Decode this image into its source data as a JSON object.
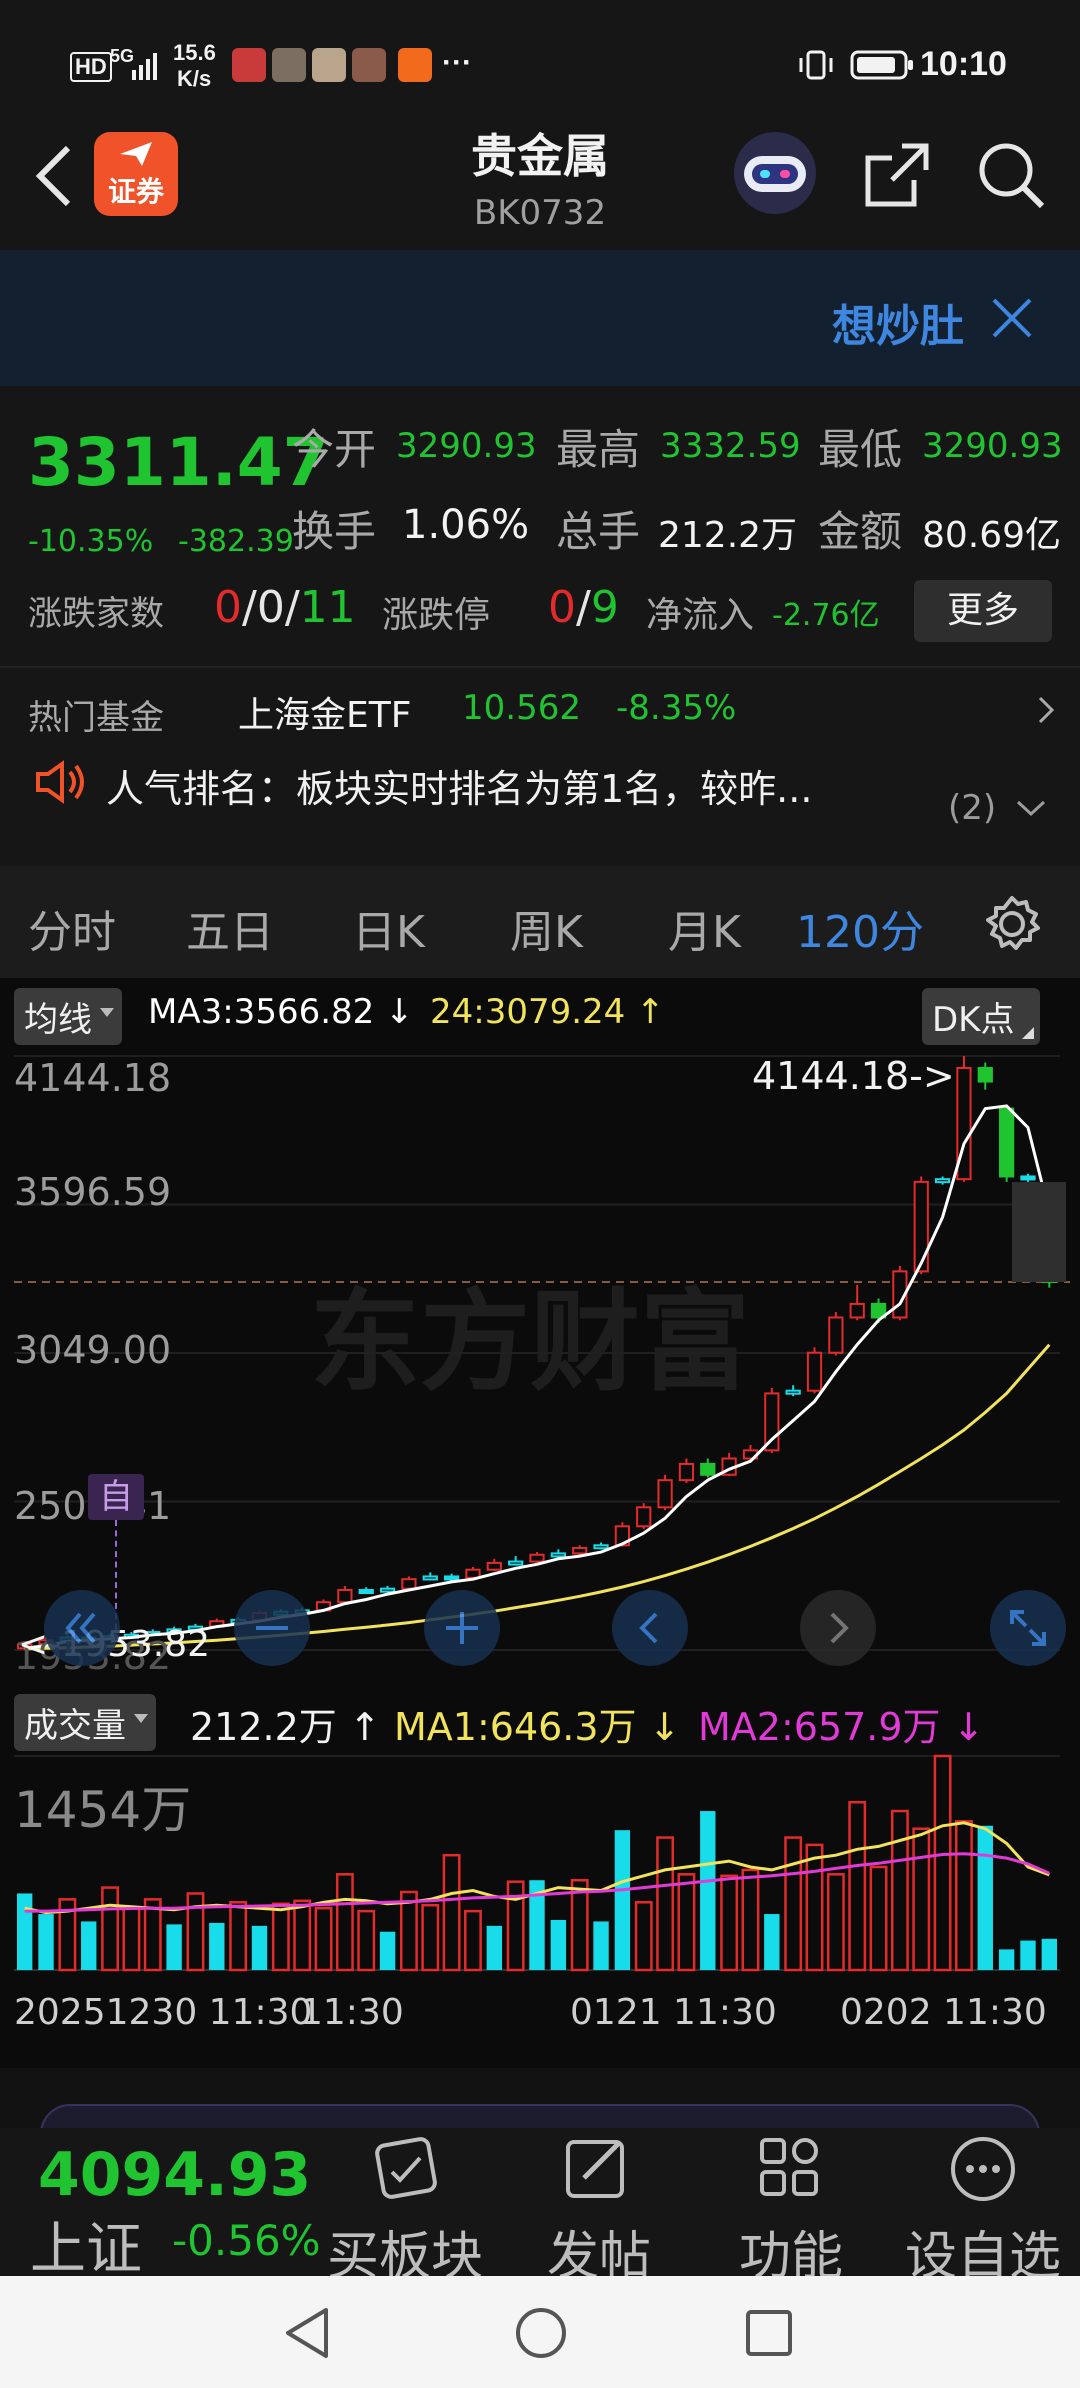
{
  "status_bar": {
    "network": "5G",
    "speed_value": "15.6",
    "speed_unit": "K/s",
    "more": "···",
    "time": "10:10",
    "hd": "HD"
  },
  "header": {
    "title": "贵金属",
    "code": "BK0732",
    "brand_badge": "证券"
  },
  "banner": {
    "text": "想炒肚"
  },
  "quote": {
    "price": "3311.47",
    "change_pct": "-10.35%",
    "change_abs": "-382.39",
    "open_label": "今开",
    "open_value": "3290.93",
    "high_label": "最高",
    "high_value": "3332.59",
    "low_label": "最低",
    "low_value": "3290.93",
    "turnover_label": "换手",
    "turnover_value": "1.06%",
    "volume_label": "总手",
    "volume_value": "212.2万",
    "amount_label": "金额",
    "amount_value": "80.69亿",
    "updown_label": "涨跌家数",
    "up": "0",
    "flat": "0",
    "down": "11",
    "limit_label": "涨跌停",
    "limit_up": "0",
    "limit_down": "9",
    "netflow_label": "净流入",
    "netflow_value": "-2.76亿",
    "more_button": "更多",
    "fund_label": "热门基金",
    "fund_name": "上海金ETF",
    "fund_price": "10.562",
    "fund_change": "-8.35%",
    "rank_text": "人气排名：板块实时排名为第1名，较昨...",
    "rank_count": "(2)"
  },
  "tabs": {
    "items": [
      "分时",
      "五日",
      "日K",
      "周K",
      "月K",
      "120分"
    ],
    "active_index": 5
  },
  "chart_legend": {
    "ma_selector": "均线",
    "ma3": "MA3:3566.82",
    "ma3_arrow": "↓",
    "ma24": "24:3079.24",
    "ma24_arrow": "↑",
    "dk_button": "DK点",
    "volume_selector": "成交量",
    "vol_value": "212.2万",
    "vol_arrow": "↑",
    "vol_ma1": "MA1:646.3万",
    "vol_ma1_arrow": "↓",
    "vol_ma2": "MA2:657.9万",
    "vol_ma2_arrow": "↓",
    "vol_max": "1454万",
    "price_high_marker": "4144.18->",
    "price_low_marker": "<-1953.82",
    "watermark": "东方财富",
    "auto_label": "自"
  },
  "chart_data": {
    "type": "candlestick",
    "y_ticks": [
      "4144.18",
      "3596.59",
      "3049.00",
      "2501.41",
      "1953.82"
    ],
    "ylim": [
      1953.82,
      4144.18
    ],
    "x_labels": [
      "20251230 11:30",
      "11:30",
      "0121 11:30",
      "0202 11:30"
    ],
    "candles": [
      {
        "o": 1960,
        "c": 1975,
        "h": 1985,
        "l": 1955
      },
      {
        "o": 1975,
        "c": 1990,
        "h": 2000,
        "l": 1965
      },
      {
        "o": 1990,
        "c": 2000,
        "h": 2010,
        "l": 1980
      },
      {
        "o": 2000,
        "c": 1995,
        "h": 2010,
        "l": 1985
      },
      {
        "o": 1995,
        "c": 2005,
        "h": 2015,
        "l": 1990
      },
      {
        "o": 2005,
        "c": 2010,
        "h": 2020,
        "l": 2000
      },
      {
        "o": 2010,
        "c": 2020,
        "h": 2030,
        "l": 2005
      },
      {
        "o": 2020,
        "c": 2030,
        "h": 2040,
        "l": 2015
      },
      {
        "o": 2030,
        "c": 2040,
        "h": 2050,
        "l": 2025
      },
      {
        "o": 2040,
        "c": 2060,
        "h": 2070,
        "l": 2035
      },
      {
        "o": 2060,
        "c": 2065,
        "h": 2075,
        "l": 2055
      },
      {
        "o": 2065,
        "c": 2090,
        "h": 2100,
        "l": 2060
      },
      {
        "o": 2090,
        "c": 2095,
        "h": 2105,
        "l": 2085
      },
      {
        "o": 2095,
        "c": 2100,
        "h": 2110,
        "l": 2090
      },
      {
        "o": 2100,
        "c": 2130,
        "h": 2140,
        "l": 2095
      },
      {
        "o": 2130,
        "c": 2175,
        "h": 2190,
        "l": 2125
      },
      {
        "o": 2175,
        "c": 2170,
        "h": 2185,
        "l": 2160
      },
      {
        "o": 2170,
        "c": 2180,
        "h": 2190,
        "l": 2165
      },
      {
        "o": 2180,
        "c": 2215,
        "h": 2225,
        "l": 2175
      },
      {
        "o": 2215,
        "c": 2225,
        "h": 2240,
        "l": 2210
      },
      {
        "o": 2225,
        "c": 2220,
        "h": 2235,
        "l": 2210
      },
      {
        "o": 2220,
        "c": 2250,
        "h": 2260,
        "l": 2215
      },
      {
        "o": 2250,
        "c": 2275,
        "h": 2290,
        "l": 2245
      },
      {
        "o": 2275,
        "c": 2280,
        "h": 2300,
        "l": 2265
      },
      {
        "o": 2280,
        "c": 2305,
        "h": 2315,
        "l": 2275
      },
      {
        "o": 2305,
        "c": 2310,
        "h": 2325,
        "l": 2295
      },
      {
        "o": 2310,
        "c": 2330,
        "h": 2340,
        "l": 2300
      },
      {
        "o": 2330,
        "c": 2340,
        "h": 2350,
        "l": 2325
      },
      {
        "o": 2340,
        "c": 2410,
        "h": 2425,
        "l": 2335
      },
      {
        "o": 2410,
        "c": 2480,
        "h": 2495,
        "l": 2400
      },
      {
        "o": 2480,
        "c": 2580,
        "h": 2600,
        "l": 2470
      },
      {
        "o": 2580,
        "c": 2640,
        "h": 2660,
        "l": 2570
      },
      {
        "o": 2640,
        "c": 2600,
        "h": 2660,
        "l": 2590
      },
      {
        "o": 2600,
        "c": 2660,
        "h": 2680,
        "l": 2595
      },
      {
        "o": 2660,
        "c": 2690,
        "h": 2710,
        "l": 2650
      },
      {
        "o": 2690,
        "c": 2900,
        "h": 2920,
        "l": 2680
      },
      {
        "o": 2900,
        "c": 2910,
        "h": 2930,
        "l": 2890
      },
      {
        "o": 2910,
        "c": 3050,
        "h": 3070,
        "l": 2900
      },
      {
        "o": 3050,
        "c": 3180,
        "h": 3200,
        "l": 3040
      },
      {
        "o": 3180,
        "c": 3230,
        "h": 3300,
        "l": 3170
      },
      {
        "o": 3230,
        "c": 3180,
        "h": 3250,
        "l": 3160
      },
      {
        "o": 3180,
        "c": 3350,
        "h": 3370,
        "l": 3170
      },
      {
        "o": 3350,
        "c": 3680,
        "h": 3700,
        "l": 3340
      },
      {
        "o": 3680,
        "c": 3690,
        "h": 3700,
        "l": 3670
      },
      {
        "o": 3690,
        "c": 4100,
        "h": 4144.18,
        "l": 3680
      },
      {
        "o": 4100,
        "c": 4050,
        "h": 4120,
        "l": 4020
      },
      {
        "o": 3950,
        "c": 3700,
        "h": 3960,
        "l": 3680
      },
      {
        "o": 3700,
        "c": 3690,
        "h": 3710,
        "l": 3680
      },
      {
        "o": 3580,
        "c": 3311,
        "h": 3600,
        "l": 3290
      }
    ],
    "ma3": [
      1960,
      1970,
      1985,
      1990,
      1995,
      2000,
      2010,
      2015,
      2025,
      2040,
      2050,
      2060,
      2075,
      2085,
      2100,
      2125,
      2140,
      2160,
      2175,
      2190,
      2205,
      2215,
      2235,
      2255,
      2270,
      2290,
      2300,
      2315,
      2345,
      2385,
      2440,
      2520,
      2580,
      2620,
      2650,
      2730,
      2800,
      2870,
      2980,
      3080,
      3170,
      3230,
      3380,
      3550,
      3820,
      3950,
      3960,
      3880,
      3566.82
    ],
    "ma24": [
      1958,
      1960,
      1962,
      1965,
      1968,
      1972,
      1976,
      1980,
      1985,
      1990,
      1996,
      2002,
      2008,
      2015,
      2022,
      2030,
      2038,
      2046,
      2055,
      2065,
      2075,
      2086,
      2097,
      2110,
      2123,
      2137,
      2152,
      2168,
      2186,
      2206,
      2228,
      2252,
      2278,
      2306,
      2336,
      2368,
      2402,
      2438,
      2478,
      2520,
      2565,
      2612,
      2660,
      2710,
      2765,
      2830,
      2900,
      2990,
      3079.24
    ],
    "volume": [
      {
        "v": 520,
        "up": false
      },
      {
        "v": 380,
        "up": false
      },
      {
        "v": 480,
        "up": true
      },
      {
        "v": 330,
        "up": false
      },
      {
        "v": 560,
        "up": true
      },
      {
        "v": 420,
        "up": true
      },
      {
        "v": 480,
        "up": true
      },
      {
        "v": 310,
        "up": false
      },
      {
        "v": 520,
        "up": true
      },
      {
        "v": 320,
        "up": false
      },
      {
        "v": 460,
        "up": true
      },
      {
        "v": 300,
        "up": false
      },
      {
        "v": 450,
        "up": true
      },
      {
        "v": 470,
        "up": true
      },
      {
        "v": 420,
        "up": true
      },
      {
        "v": 650,
        "up": true
      },
      {
        "v": 400,
        "up": true
      },
      {
        "v": 260,
        "up": false
      },
      {
        "v": 530,
        "up": true
      },
      {
        "v": 440,
        "up": true
      },
      {
        "v": 780,
        "up": true
      },
      {
        "v": 400,
        "up": true
      },
      {
        "v": 300,
        "up": false
      },
      {
        "v": 600,
        "up": true
      },
      {
        "v": 610,
        "up": false
      },
      {
        "v": 340,
        "up": false
      },
      {
        "v": 610,
        "up": true
      },
      {
        "v": 330,
        "up": false
      },
      {
        "v": 950,
        "up": false
      },
      {
        "v": 460,
        "up": true
      },
      {
        "v": 900,
        "up": true
      },
      {
        "v": 650,
        "up": true
      },
      {
        "v": 1080,
        "up": false
      },
      {
        "v": 640,
        "up": true
      },
      {
        "v": 680,
        "up": true
      },
      {
        "v": 380,
        "up": false
      },
      {
        "v": 900,
        "up": true
      },
      {
        "v": 850,
        "up": true
      },
      {
        "v": 650,
        "up": true
      },
      {
        "v": 1140,
        "up": true
      },
      {
        "v": 700,
        "up": true
      },
      {
        "v": 1080,
        "up": true
      },
      {
        "v": 960,
        "up": true
      },
      {
        "v": 1454,
        "up": true
      },
      {
        "v": 1010,
        "up": true
      },
      {
        "v": 980,
        "up": false
      },
      {
        "v": 140,
        "up": false
      },
      {
        "v": 200,
        "up": false
      },
      {
        "v": 212,
        "up": false
      }
    ],
    "vol_ma1": [
      420,
      390,
      400,
      420,
      440,
      430,
      420,
      410,
      430,
      440,
      430,
      420,
      410,
      430,
      460,
      480,
      470,
      450,
      460,
      480,
      520,
      540,
      500,
      480,
      520,
      560,
      550,
      540,
      600,
      640,
      680,
      700,
      720,
      740,
      700,
      680,
      720,
      760,
      780,
      820,
      840,
      880,
      920,
      980,
      1000,
      960,
      860,
      700,
      646.3
    ],
    "vol_ma2": [
      400,
      400,
      405,
      410,
      415,
      418,
      420,
      420,
      425,
      430,
      432,
      435,
      438,
      440,
      445,
      450,
      455,
      460,
      465,
      470,
      480,
      490,
      495,
      500,
      510,
      520,
      530,
      535,
      545,
      560,
      575,
      590,
      605,
      620,
      630,
      640,
      655,
      670,
      690,
      710,
      725,
      745,
      765,
      785,
      790,
      780,
      760,
      720,
      657.9
    ]
  },
  "bottom_bar": {
    "index_value": "4094.93",
    "index_name": "上证",
    "index_change": "-0.56%",
    "items": [
      "买板块",
      "发帖",
      "功能",
      "设自选"
    ]
  },
  "colors": {
    "up": "#e42b2b",
    "down": "#1fc430",
    "flat_candle": "#19dcea",
    "ma3": "#ffffff",
    "ma24": "#f2e35c",
    "vol_ma1": "#f2e35c",
    "vol_ma2": "#e23ad6",
    "accent": "#3e86e0"
  }
}
